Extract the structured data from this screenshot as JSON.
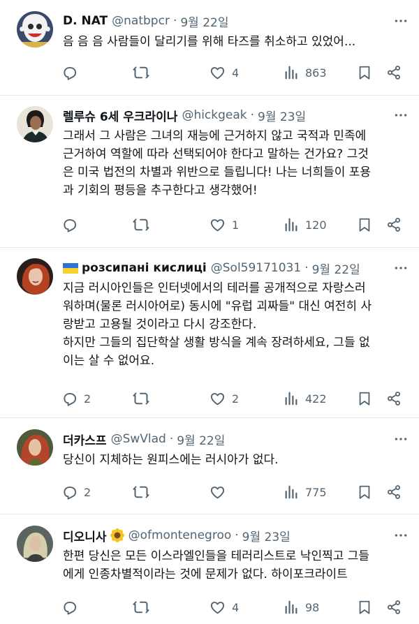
{
  "tweets": [
    {
      "name": "D. NAT",
      "handle": "@natbpcr",
      "dot": "·",
      "date": "9월 22일",
      "text": "음 음 음 사람들이 달리기를 위해 타즈를 취소하고 있었어...",
      "replies": "",
      "likes": "4",
      "views": "863",
      "avatar_icon": "cartoon-character-avatar"
    },
    {
      "name": "렐루슈 6세 우크라이나",
      "handle": "@hickgeak",
      "dot": "·",
      "date": "9월 23일",
      "text": "그래서 그 사람은 그녀의 재능에 근거하지 않고 국적과 민족에\n근거하여 역할에 따라 선택되어야 한다고 말하는 건가요? 그것\n은 미국 법전의 차별과 위반으로 들립니다! 나는 너희들이 포용\n과 기회의 평등을 추구한다고 생각했어!",
      "replies": "",
      "likes": "1",
      "views": "120",
      "avatar_icon": "portrait-avatar"
    },
    {
      "name": "розсипані кислиці",
      "handle": "@Sol59171031",
      "dot": "·",
      "date": "9월 22일",
      "text": "지금 러시아인들은 인터넷에서의 테러를 공개적으로 자랑스러\n워하며(물론 러시아어로) 동시에 \"유럽 괴짜들\" 대신 여전히 사\n랑받고 고용될 것이라고 다시 강조한다.\n하지만 그들의 집단학살 생활 방식을 계속 장려하세요, 그들 없\n이는 살 수 없어요.",
      "replies": "2",
      "likes": "2",
      "views": "422",
      "avatar_icon": "red-hair-woman-avatar",
      "name_flag": "ukraine-flag-icon"
    },
    {
      "name": "더카스프",
      "handle": "@SwVlad",
      "dot": "·",
      "date": "9월 22일",
      "text": "당신이 지체하는 원피스에는 러시아가 없다.",
      "replies": "2",
      "likes": "",
      "views": "775",
      "avatar_icon": "painted-woman-avatar"
    },
    {
      "name": "디오니사",
      "handle": "@ofmontenegroo",
      "dot": "·",
      "date": "9월 23일",
      "text": "한편 당신은 모든 이스라엘인들을 테러리스트로 낙인찍고 그들\n에게 인종차별적이라는 것에 문제가 없다. 하이포크라이트",
      "replies": "",
      "likes": "4",
      "views": "98",
      "avatar_icon": "blonde-woman-avatar",
      "name_emoji": "sunflower-icon"
    }
  ],
  "colors": {
    "text": "#0f1419",
    "secondary": "#536471",
    "divider": "#e7e9ea",
    "flag_blue": "#2f6fd8",
    "flag_yellow": "#f7d22c"
  }
}
